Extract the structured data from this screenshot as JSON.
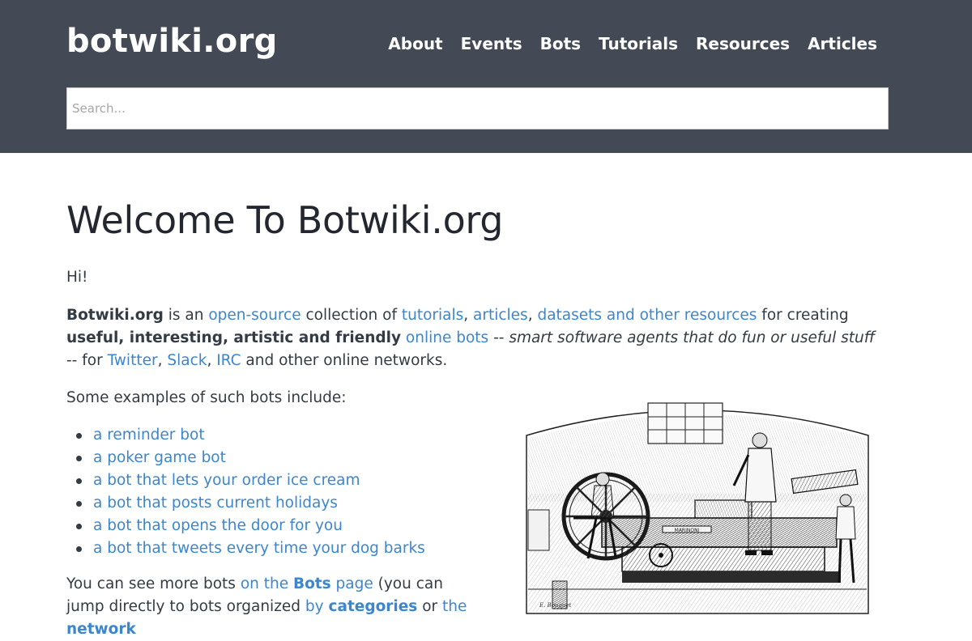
{
  "header": {
    "logo": "botwiki.org",
    "nav": [
      "About",
      "Events",
      "Bots",
      "Tutorials",
      "Resources",
      "Articles"
    ],
    "search_placeholder": "Search..."
  },
  "main": {
    "title": "Welcome To Botwiki.org",
    "greeting": "Hi!",
    "intro": {
      "site_name": "Botwiki.org",
      "t1": " is an ",
      "link_open_source": "open-source",
      "t2": " collection of ",
      "link_tutorials": "tutorials",
      "t3": ", ",
      "link_articles": "articles",
      "t4": ", ",
      "link_datasets": "datasets and other resources",
      "t5": " for creating ",
      "bold_qualities": "useful, interesting, artistic and friendly",
      "t6": " ",
      "link_online_bots": "online bots",
      "t7": " -- ",
      "italic_definition": "smart software agents that do fun or useful stuff",
      "t8": " -- for ",
      "link_twitter": "Twitter",
      "t9": ", ",
      "link_slack": "Slack",
      "t10": ", ",
      "link_irc": "IRC",
      "t11": " and other online networks."
    },
    "examples_intro": "Some examples of such bots include:",
    "examples": [
      "a reminder bot",
      "a poker game bot",
      "a bot that lets your order ice cream",
      "a bot that posts current holidays",
      "a bot that opens the door for you",
      "a bot that tweets every time your dog barks"
    ],
    "more": {
      "t1": "You can see more bots ",
      "link_on_the": "on the ",
      "link_bots_bold": "Bots",
      "link_page": " page",
      "t2": " (you can jump directly to bots organized ",
      "link_by": "by ",
      "link_categories": "categories",
      "t3": " or ",
      "link_the": "the ",
      "link_network": "network"
    }
  },
  "illustration": {
    "caption_plate": "MARINONI",
    "signature": "E. Bouquet"
  }
}
